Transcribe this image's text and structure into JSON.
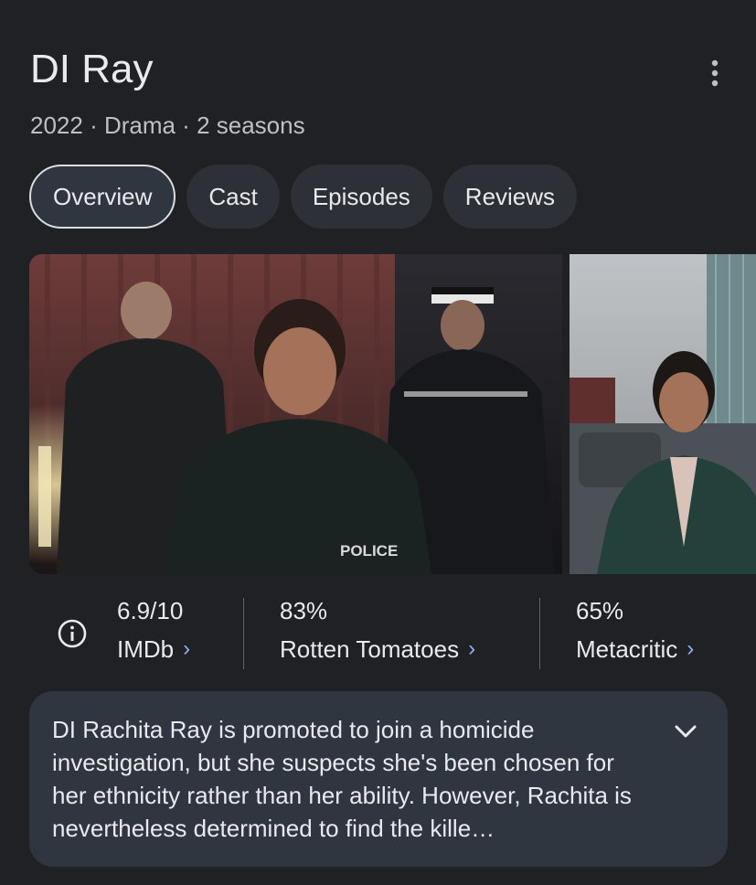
{
  "header": {
    "title": "DI Ray",
    "subtitle": "2022 · Drama · 2 seasons",
    "more_icon": "more-vert-icon"
  },
  "tabs": [
    {
      "label": "Overview",
      "active": true
    },
    {
      "label": "Cast",
      "active": false
    },
    {
      "label": "Episodes",
      "active": false
    },
    {
      "label": "Reviews",
      "active": false
    }
  ],
  "images": [
    {
      "description": "police-officers-scene",
      "badge_text": "POLICE"
    },
    {
      "description": "woman-in-green-coat-portrait"
    }
  ],
  "ratings": {
    "info_icon": "info-icon",
    "items": [
      {
        "score": "6.9/10",
        "source": "IMDb"
      },
      {
        "score": "83%",
        "source": "Rotten Tomatoes"
      },
      {
        "score": "65%",
        "source": "Metacritic"
      }
    ],
    "chevron": "›"
  },
  "description": {
    "text": "DI Rachita Ray is promoted to join a homicide investigation, but she suspects she's been chosen for her ethnicity rather than her ability. However, Rachita is nevertheless determined to find the kille…",
    "expand_icon": "chevron-down-icon"
  },
  "colors": {
    "background": "#202124",
    "card": "#303640",
    "accent": "#8ab4f8",
    "text": "#e8eaed"
  }
}
